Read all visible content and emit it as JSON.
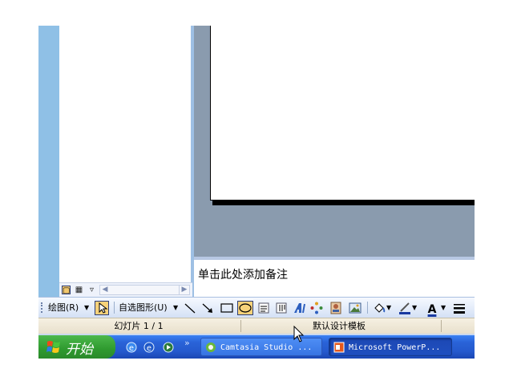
{
  "notes": {
    "placeholder_text": "单击此处添加备注"
  },
  "drawing_toolbar": {
    "draw_menu": "绘图(R)",
    "autoshapes_menu": "自选图形(U)",
    "icons": [
      "select-objects-icon",
      "line-icon",
      "arrow-icon",
      "rectangle-icon",
      "oval-icon",
      "text-box-icon",
      "vertical-text-box-icon",
      "wordart-icon",
      "diagram-icon",
      "clip-art-icon",
      "picture-icon",
      "fill-color-icon",
      "line-color-icon",
      "font-color-icon",
      "line-style-icon"
    ],
    "font_color_glyph": "A"
  },
  "status_bar": {
    "slide_indicator": "幻灯片 1 / 1",
    "design_template": "默认设计模板"
  },
  "taskbar": {
    "start_label": "开始",
    "quick_launch_more": "»",
    "tasks": [
      {
        "label": "Camtasia Studio ...",
        "active": false
      },
      {
        "label": "Microsoft PowerP...",
        "active": true
      }
    ]
  },
  "colors": {
    "taskbar_blue": "#2459cd",
    "start_green": "#2f9a2f",
    "slide_background": "#8a9bae",
    "highlight": "#f7d27a"
  }
}
